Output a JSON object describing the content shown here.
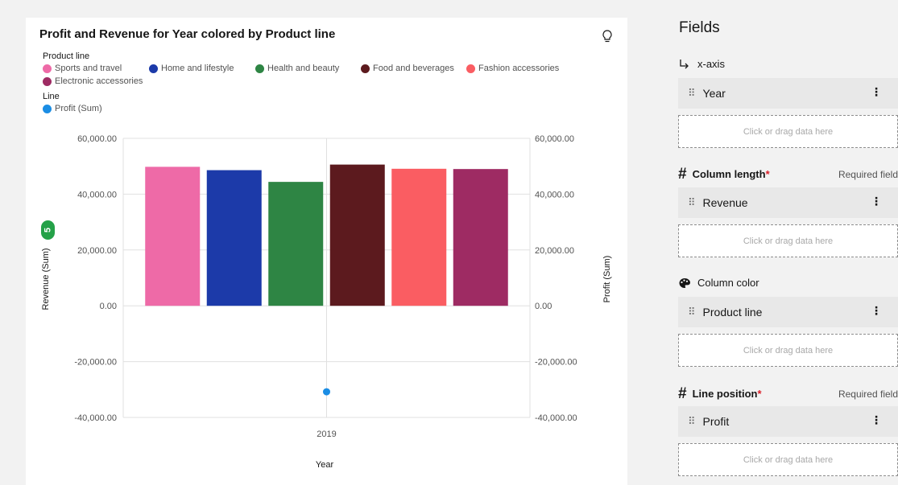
{
  "chart_card": {
    "title": "Profit and Revenue for Year colored by Product line",
    "legend_product_heading": "Product line",
    "legend_line_heading": "Line",
    "product_lines": [
      {
        "label": "Sports and travel",
        "color": "#ee6aa7"
      },
      {
        "label": "Home and lifestyle",
        "color": "#1c3aa9"
      },
      {
        "label": "Health and beauty",
        "color": "#2e8544"
      },
      {
        "label": "Food and beverages",
        "color": "#5c1a1e"
      },
      {
        "label": "Fashion accessories",
        "color": "#fa5d62"
      },
      {
        "label": "Electronic accessories",
        "color": "#9e2b63"
      }
    ],
    "line_series": {
      "label": "Profit (Sum)",
      "color": "#1b8de4"
    },
    "summary_badge": "5"
  },
  "chart_data": {
    "type": "bar",
    "title": "Profit and Revenue for Year colored by Product line",
    "xlabel": "Year",
    "ylabel": "Revenue (Sum)",
    "y2label": "Profit (Sum)",
    "categories": [
      "2019"
    ],
    "series": [
      {
        "name": "Sports and travel",
        "values": [
          49800
        ]
      },
      {
        "name": "Home and lifestyle",
        "values": [
          48600
        ]
      },
      {
        "name": "Health and beauty",
        "values": [
          44400
        ]
      },
      {
        "name": "Food and beverages",
        "values": [
          50600
        ]
      },
      {
        "name": "Fashion accessories",
        "values": [
          49100
        ]
      },
      {
        "name": "Electronic accessories",
        "values": [
          49000
        ]
      }
    ],
    "line": {
      "name": "Profit (Sum)",
      "values": [
        -30800
      ]
    },
    "ylim": [
      -40000,
      60000
    ],
    "y2lim": [
      -40000,
      60000
    ],
    "yticks": [
      "60,000.00",
      "40,000.00",
      "20,000.00",
      "0.00",
      "-20,000.00",
      "-40,000.00"
    ],
    "y2ticks": [
      "60,000.00",
      "40,000.00",
      "20,000.00",
      "0.00",
      "-20,000.00",
      "-40,000.00"
    ],
    "grid": true,
    "legend_position": "top-left"
  },
  "fields_panel": {
    "title": "Fields",
    "sections": [
      {
        "label": "x-axis",
        "icon": "x-axis-icon",
        "required": false,
        "required_text": "",
        "value": "Year",
        "drop_text": "Click or drag data here"
      },
      {
        "label": "Column length",
        "icon": "hash-icon",
        "required": true,
        "required_mark": "*",
        "required_text": "Required field",
        "value": "Revenue",
        "drop_text": "Click or drag data here"
      },
      {
        "label": "Column color",
        "icon": "palette-icon",
        "required": false,
        "required_text": "",
        "value": "Product line",
        "drop_text": "Click or drag data here"
      },
      {
        "label": "Line position",
        "icon": "hash-icon",
        "required": true,
        "required_mark": "*",
        "required_text": "Required field",
        "value": "Profit",
        "drop_text": "Click or drag data here"
      }
    ]
  }
}
